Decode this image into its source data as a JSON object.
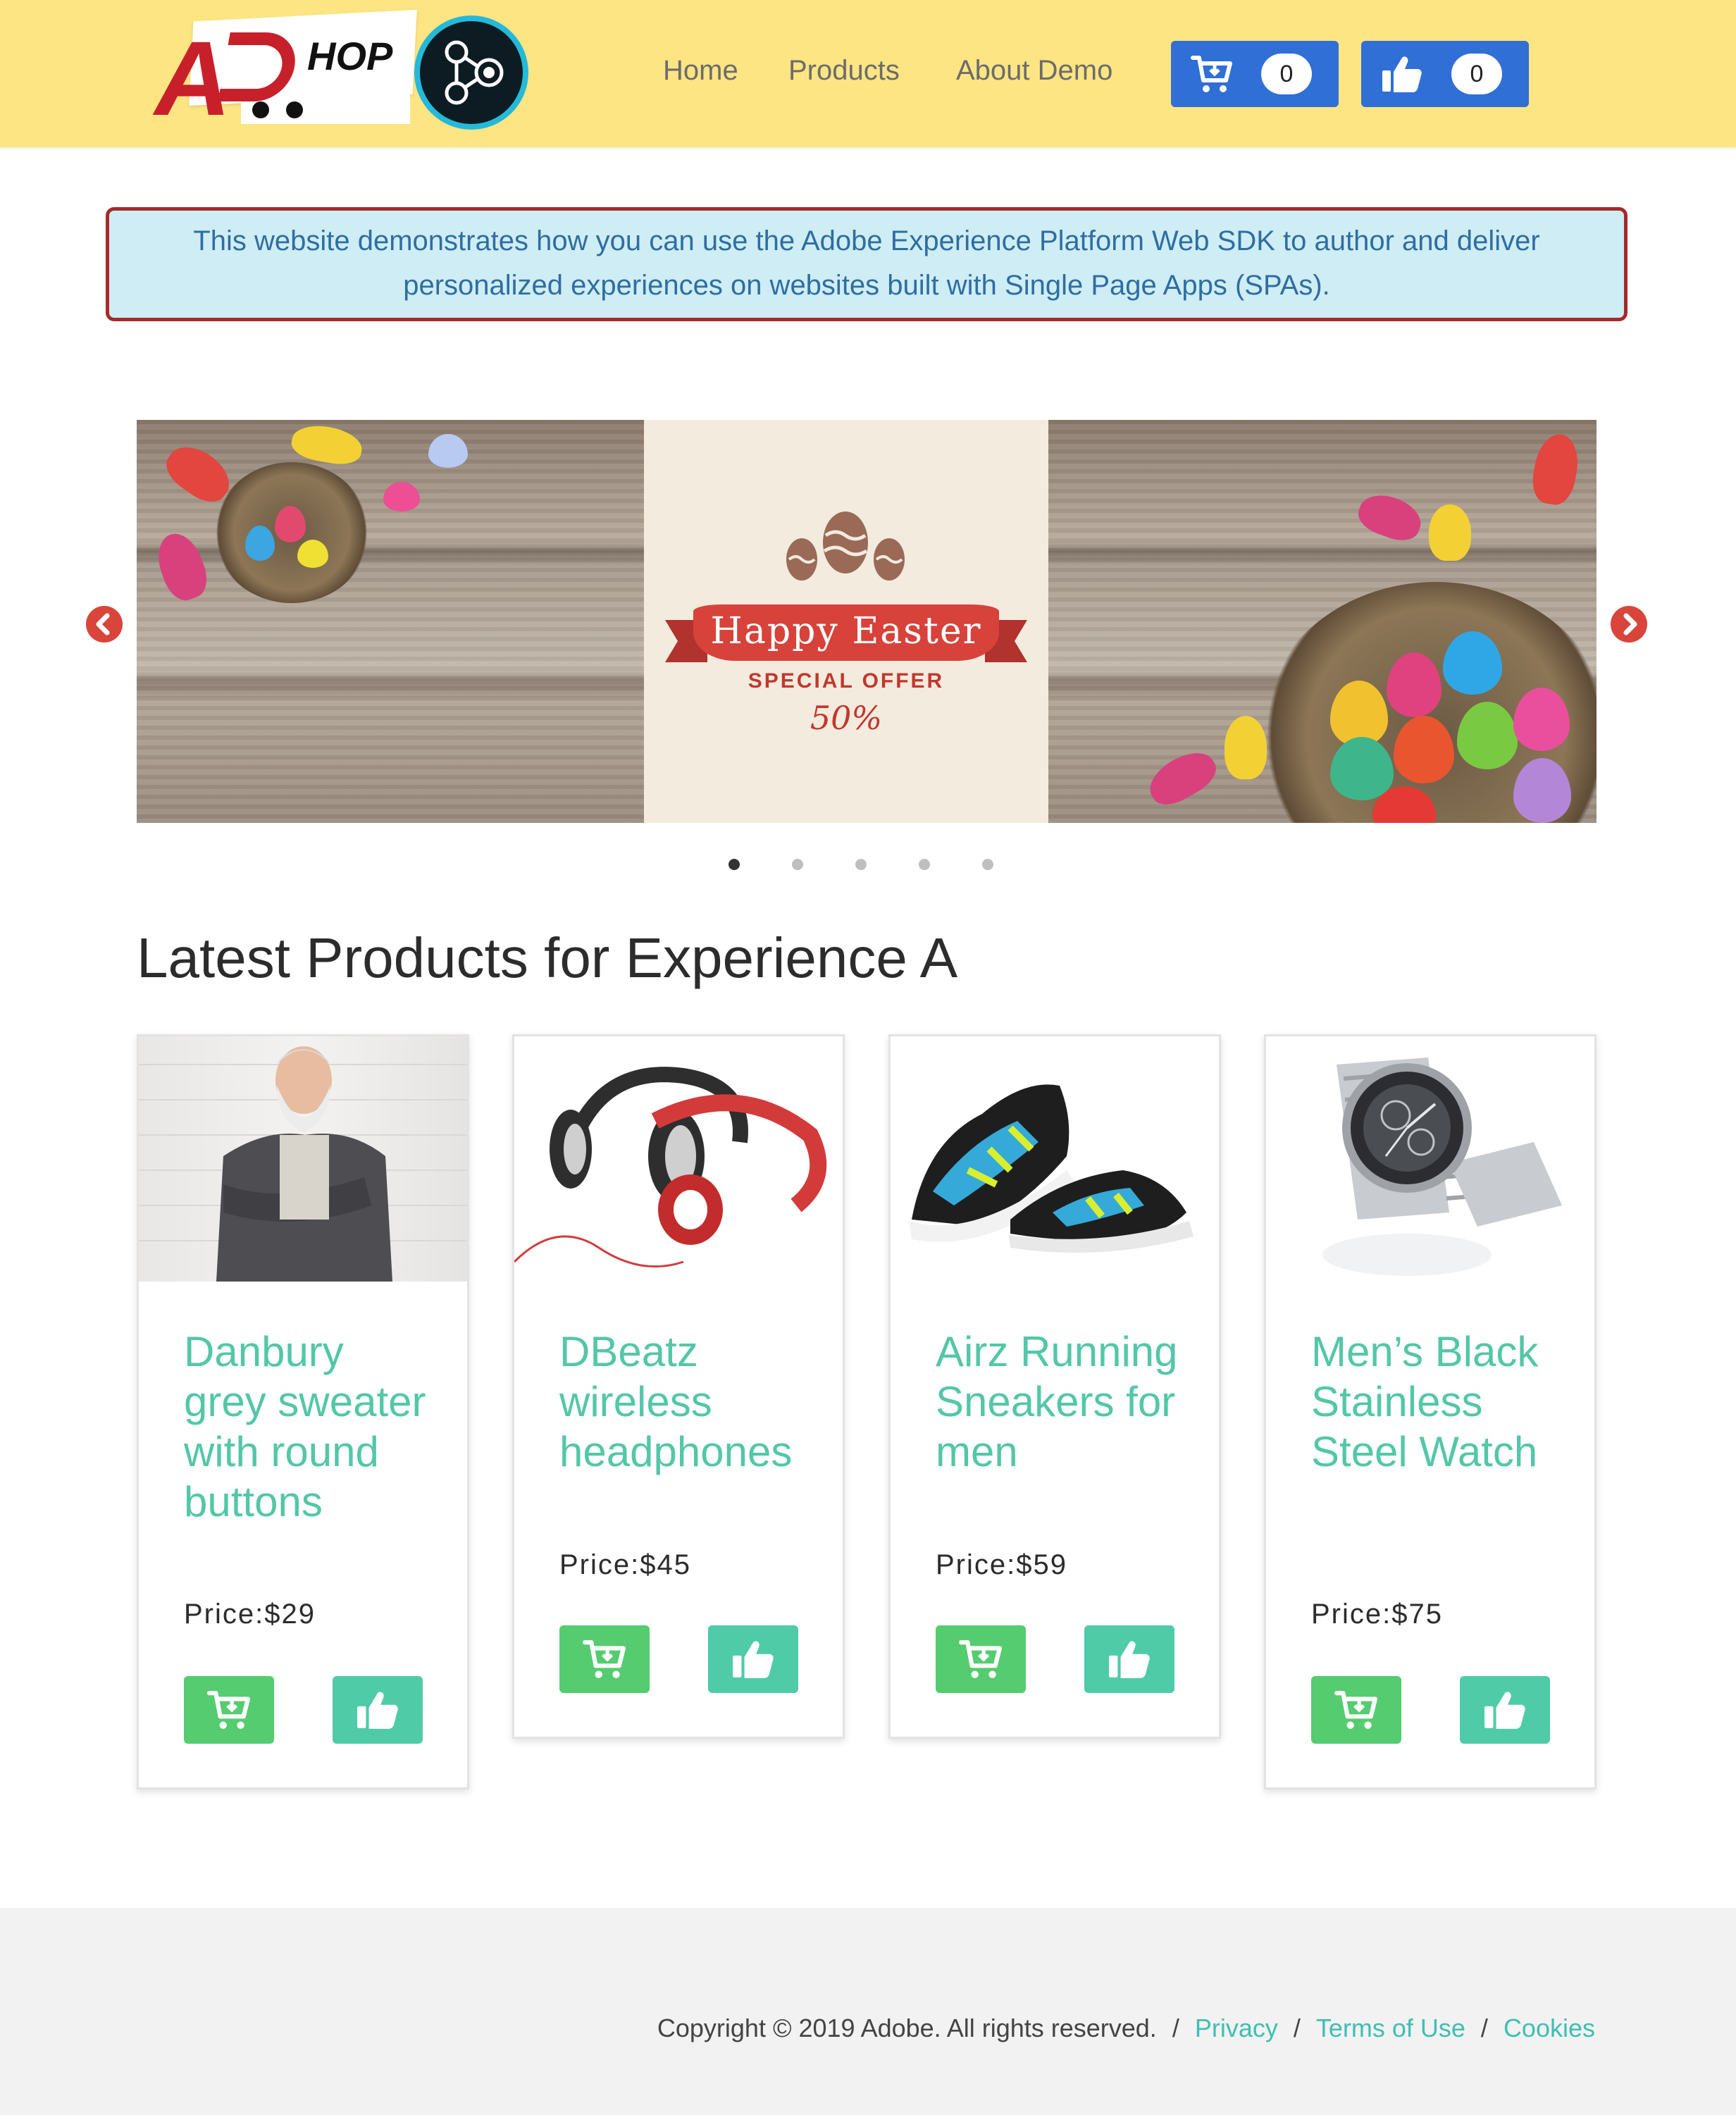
{
  "header": {
    "logo_text": "HOP",
    "nav": [
      {
        "label": "Home"
      },
      {
        "label": "Products"
      },
      {
        "label": "About Demo"
      }
    ],
    "cart_count": "0",
    "like_count": "0"
  },
  "alert": {
    "line1": "This website demonstrates how you can use the Adobe Experience Platform Web SDK to author and deliver",
    "line2": "personalized experiences on websites built with Single Page Apps (SPAs)."
  },
  "carousel": {
    "banner_title": "Happy Easter",
    "banner_subtitle": "SPECIAL OFFER",
    "banner_discount": "50%",
    "slides": 5,
    "active_slide": 1,
    "prev_icon": "chevron-left-icon",
    "next_icon": "chevron-right-icon"
  },
  "section": {
    "title": "Latest Products for Experience A"
  },
  "products": [
    {
      "title": "Danbury grey sweater with round buttons",
      "price": "Price:$29"
    },
    {
      "title": "DBeatz wireless headphones",
      "price": "Price:$45"
    },
    {
      "title": "Airz Running Sneakers for men",
      "price": "Price:$59"
    },
    {
      "title": "Men’s Black Stainless Steel Watch",
      "price": "Price:$75"
    }
  ],
  "footer": {
    "copyright": "Copyright © 2019 Adobe. All rights reserved.",
    "separator": "/",
    "links": [
      "Privacy",
      "Terms of Use",
      "Cookies"
    ]
  },
  "colors": {
    "header_bg": "#fde583",
    "nav_button": "#2f6fd6",
    "product_title": "#53c7a8",
    "cart_button": "#55cc6f",
    "like_button": "#4fcba8",
    "alert_border": "#a52a2a",
    "alert_bg": "#cfedf4",
    "footer_link": "#3fbfb2"
  }
}
